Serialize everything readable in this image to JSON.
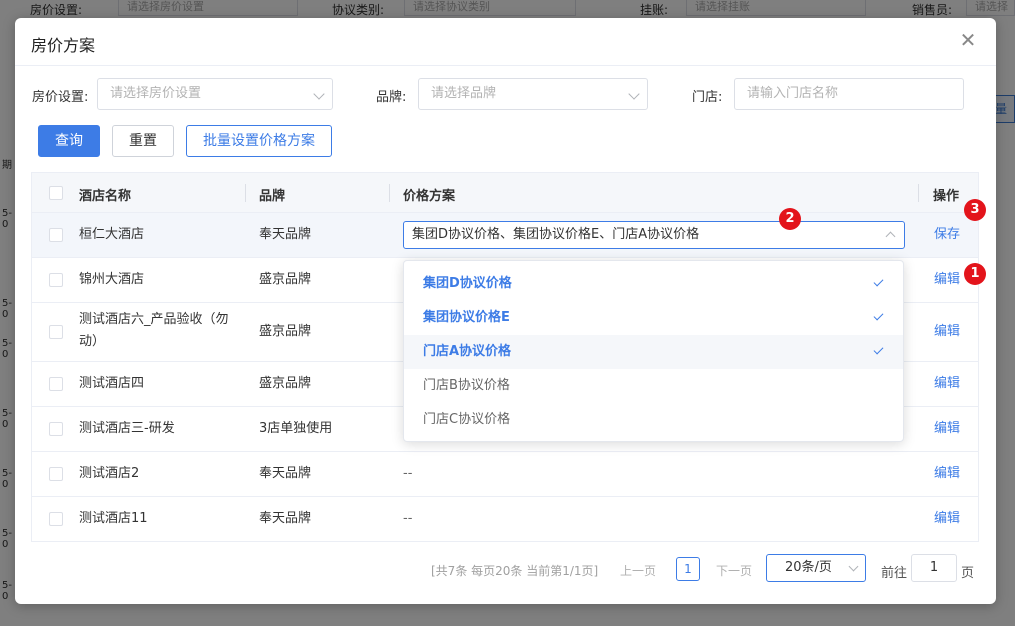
{
  "background": {
    "filters": [
      "房价设置:",
      "请选择房价设置",
      "协议类别:",
      "请选择协议类别",
      "挂账:",
      "请选择挂账",
      "销售员:",
      "请选择"
    ],
    "side_fragments": [
      "期",
      "5-0",
      "5-0",
      "5-0",
      "5-0",
      "5-0",
      "5-0",
      "5-0",
      "5-0",
      "5-0"
    ],
    "right_button": "量"
  },
  "dialog": {
    "title": "房价方案",
    "close_icon": "close-icon"
  },
  "filters": {
    "price_setting": {
      "label": "房价设置:",
      "placeholder": "请选择房价设置"
    },
    "brand": {
      "label": "品牌:",
      "placeholder": "请选择品牌"
    },
    "store": {
      "label": "门店:",
      "placeholder": "请输入门店名称"
    }
  },
  "buttons": {
    "query": "查询",
    "reset": "重置",
    "batch": "批量设置价格方案"
  },
  "table": {
    "headers": {
      "name": "酒店名称",
      "brand": "品牌",
      "plan": "价格方案",
      "op": "操作"
    },
    "rows": [
      {
        "name": "桓仁大酒店",
        "brand": "奉天品牌",
        "plan": "集团D协议价格、集团协议价格E、门店A协议价格",
        "op": "保存"
      },
      {
        "name": "锦州大酒店",
        "brand": "盛京品牌",
        "plan": "",
        "op": "编辑"
      },
      {
        "name": "测试酒店六_产品验收（勿动）",
        "brand": "盛京品牌",
        "plan": "",
        "op": "编辑"
      },
      {
        "name": "测试酒店四",
        "brand": "盛京品牌",
        "plan": "",
        "op": "编辑"
      },
      {
        "name": "测试酒店三-研发",
        "brand": "3店单独使用",
        "plan": "",
        "op": "编辑"
      },
      {
        "name": "测试酒店2",
        "brand": "奉天品牌",
        "plan": "--",
        "op": "编辑"
      },
      {
        "name": "测试酒店11",
        "brand": "奉天品牌",
        "plan": "--",
        "op": "编辑"
      }
    ]
  },
  "dropdown": {
    "options": [
      {
        "label": "集团D协议价格",
        "selected": true
      },
      {
        "label": "集团协议价格E",
        "selected": true
      },
      {
        "label": "门店A协议价格",
        "selected": true
      },
      {
        "label": "门店B协议价格",
        "selected": false
      },
      {
        "label": "门店C协议价格",
        "selected": false
      }
    ]
  },
  "badges": {
    "one": "1",
    "two": "2",
    "three": "3"
  },
  "pagination": {
    "total": "[共7条 每页20条 当前第1/1页]",
    "prev": "上一页",
    "page": "1",
    "next": "下一页",
    "size": "20条/页",
    "goto": "前往",
    "goto_value": "1",
    "unit": "页"
  },
  "colors": {
    "primary": "#3d7ce6",
    "badge": "#e3141b"
  }
}
